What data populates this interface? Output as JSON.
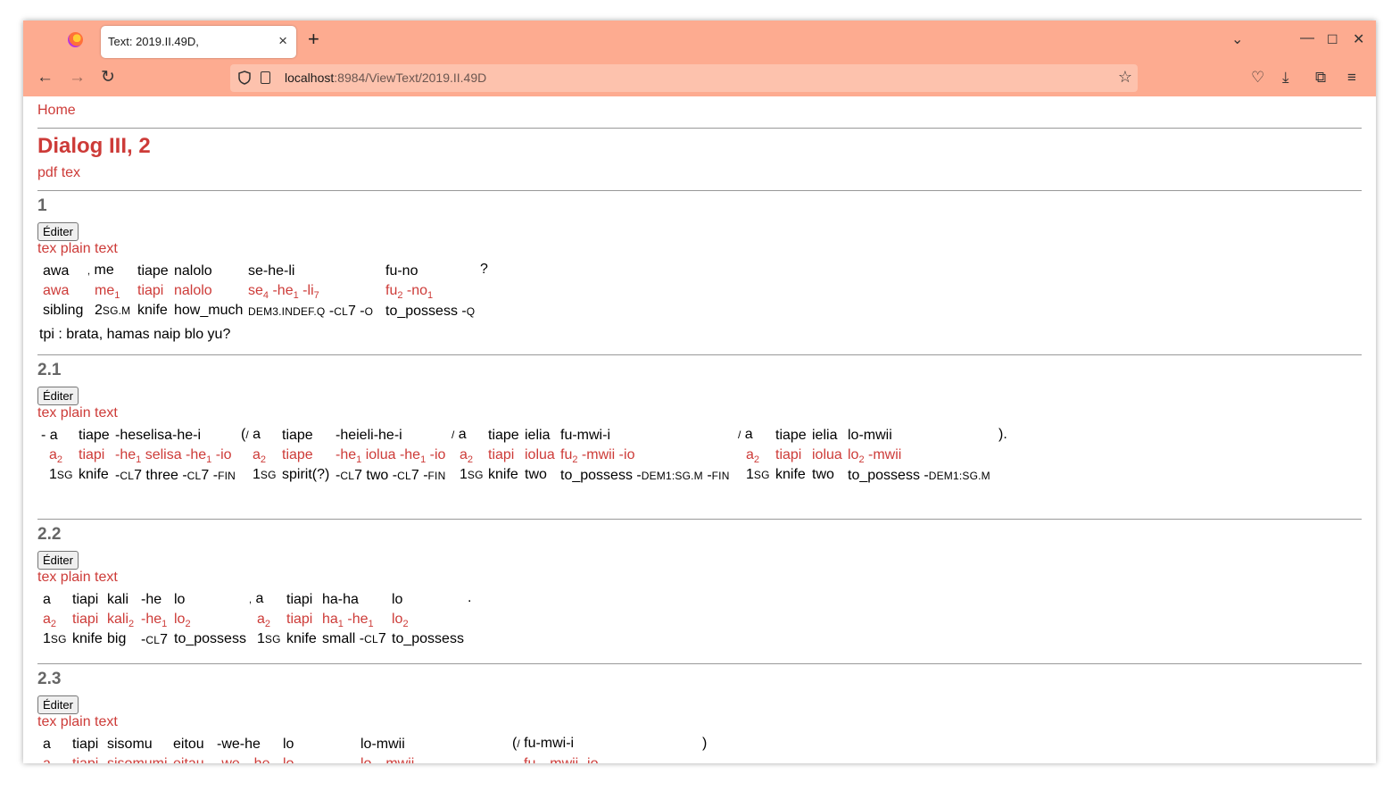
{
  "browser": {
    "tab_title": "Text: 2019.II.49D,",
    "url_host": "localhost",
    "url_rest": ":8984/ViewText/2019.II.49D"
  },
  "page": {
    "home": "Home",
    "title": "Dialog III, 2",
    "pdf": "pdf",
    "tex": "tex",
    "edit_label": "Éditer",
    "tex_link": "tex",
    "plain_text_link": "plain text"
  },
  "sections": [
    {
      "num": "1",
      "translation": "tpi : brata, hamas naip blo yu?"
    },
    {
      "num": "2.1"
    },
    {
      "num": "2.2"
    },
    {
      "num": "2.3"
    }
  ],
  "colors": {
    "accent": "#cd3b38",
    "browser_chrome": "#fdab90"
  }
}
